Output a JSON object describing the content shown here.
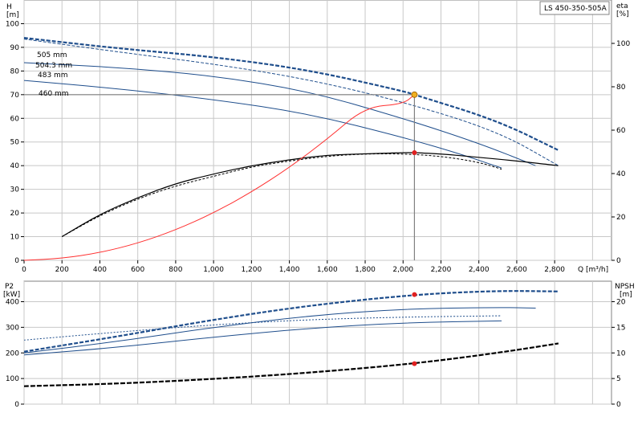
{
  "model_label": "LS 450-350-505A",
  "colors": {
    "head": "#1f4e8c",
    "power_black": "#000000",
    "system": "#ff3030",
    "duty_line": "#808080",
    "duty_point": "#f0b020",
    "marker": "#e02020"
  },
  "chart_data": [
    {
      "type": "line",
      "title": "",
      "xlabel": "Q [m³/h]",
      "ylabel": "H\n[m]",
      "ylabel_top": "H",
      "ylabel_unit": "[m]",
      "y2label_top": "eta",
      "y2label_unit": "[%]",
      "xlim": [
        0,
        3100
      ],
      "ylim": [
        0,
        110
      ],
      "y2lim": [
        0,
        100
      ],
      "x_ticks": [
        0,
        200,
        400,
        600,
        800,
        1000,
        1200,
        1400,
        1600,
        1800,
        2000,
        2200,
        2400,
        2600,
        2800
      ],
      "x_tick_labels": [
        "0",
        "200",
        "400",
        "600",
        "800",
        "1,000",
        "1,200",
        "1,400",
        "1,600",
        "1,800",
        "2,000",
        "2,200",
        "2,400",
        "2,600",
        "2,800"
      ],
      "y_ticks": [
        0,
        10,
        20,
        30,
        40,
        50,
        60,
        70,
        80,
        90,
        100
      ],
      "y2_ticks": [
        0,
        20,
        40,
        60,
        80,
        100
      ],
      "grid": true,
      "series": [
        {
          "name": "505 mm",
          "style": "dashed-thick",
          "axis": "left",
          "x": [
            0,
            500,
            1000,
            1500,
            2000,
            2060,
            2500,
            2820
          ],
          "y": [
            94,
            89.5,
            86,
            80.5,
            71.5,
            70,
            59,
            46.5
          ]
        },
        {
          "name": "504.3 mm",
          "style": "dashed",
          "axis": "left",
          "x": [
            0,
            500,
            1000,
            1500,
            2000,
            2500,
            2820
          ],
          "y": [
            93.5,
            88,
            83,
            76.5,
            67,
            54.5,
            40
          ]
        },
        {
          "name": "483 mm",
          "style": "solid-then-dashed",
          "axis": "left",
          "x": [
            0,
            500,
            1000,
            1500,
            2000,
            2400,
            2700
          ],
          "y": [
            83.5,
            81.5,
            78,
            71.5,
            60,
            49.5,
            40
          ]
        },
        {
          "name": "460 mm",
          "style": "solid-then-dashed",
          "axis": "left",
          "x": [
            0,
            500,
            1000,
            1500,
            2000,
            2300,
            2520
          ],
          "y": [
            76,
            72.5,
            68,
            62,
            52,
            45,
            39
          ]
        },
        {
          "name": "",
          "style": "eta-black",
          "axis": "left",
          "x": [
            200,
            400,
            600,
            800,
            1000,
            1200,
            1400,
            1600,
            1800,
            2000,
            2060,
            2200,
            2400,
            2600,
            2820
          ],
          "y": [
            10,
            19.5,
            26.5,
            32.5,
            36.5,
            40,
            42.5,
            44.5,
            45,
            45.5,
            45.5,
            45,
            43.5,
            42,
            40
          ]
        },
        {
          "name": "",
          "style": "eta-dashed",
          "axis": "left",
          "x": [
            200,
            400,
            600,
            800,
            1000,
            1200,
            1400,
            1600,
            1800,
            2000,
            2200,
            2400,
            2520
          ],
          "y": [
            10,
            19,
            26,
            31.5,
            35.5,
            39.5,
            42,
            44,
            45,
            45,
            44,
            41.5,
            38.5
          ]
        },
        {
          "name": "",
          "style": "system",
          "axis": "left",
          "x": [
            0,
            200,
            400,
            600,
            800,
            1000,
            1200,
            1400,
            1600,
            1800,
            2000,
            2060
          ],
          "y": [
            0,
            0.8,
            3.2,
            7.2,
            12.8,
            20,
            28.8,
            39.2,
            51.2,
            64.8,
            66,
            70
          ]
        }
      ],
      "duty_point": {
        "x": 2060,
        "y": 70
      },
      "eta_point": {
        "x": 2060,
        "y": 45.5
      }
    },
    {
      "type": "line",
      "title": "",
      "xlabel": "",
      "ylabel_top": "P2",
      "ylabel_unit": "[kW]",
      "y2label_top": "NPSH",
      "y2label_unit": "[m]",
      "xlim": [
        0,
        3100
      ],
      "ylim": [
        0,
        480
      ],
      "y2lim": [
        0,
        24
      ],
      "y_ticks": [
        0,
        100,
        200,
        300,
        400
      ],
      "y2_ticks": [
        0,
        5,
        10,
        15,
        20
      ],
      "grid": true,
      "series": [
        {
          "name": "",
          "style": "dashed-thick",
          "axis": "left",
          "x": [
            0,
            500,
            1000,
            1500,
            2060,
            2500,
            2820
          ],
          "y": [
            205,
            265,
            330,
            385,
            428,
            443,
            440
          ]
        },
        {
          "name": "",
          "style": "solid-then-dashed",
          "axis": "left",
          "x": [
            0,
            500,
            1000,
            1500,
            2000,
            2500,
            2700
          ],
          "y": [
            200,
            245,
            300,
            345,
            372,
            378,
            375
          ]
        },
        {
          "name": "",
          "style": "dotted",
          "axis": "left",
          "x": [
            0,
            500,
            1000,
            1500,
            2000,
            2520
          ],
          "y": [
            250,
            282,
            310,
            330,
            340,
            345
          ]
        },
        {
          "name": "",
          "style": "solid-then-dashed",
          "axis": "left",
          "x": [
            0,
            500,
            1000,
            1500,
            2000,
            2520
          ],
          "y": [
            192,
            222,
            262,
            296,
            318,
            325
          ]
        },
        {
          "name": "",
          "style": "npsh-black",
          "axis": "left",
          "x": [
            0,
            500,
            1000,
            1500,
            2060,
            2500,
            2820
          ],
          "y": [
            70,
            80,
            98,
            122,
            158,
            200,
            237
          ]
        }
      ],
      "power_point": {
        "x": 2060,
        "y": 428
      },
      "npsh_point": {
        "x": 2060,
        "y": 158
      }
    }
  ]
}
